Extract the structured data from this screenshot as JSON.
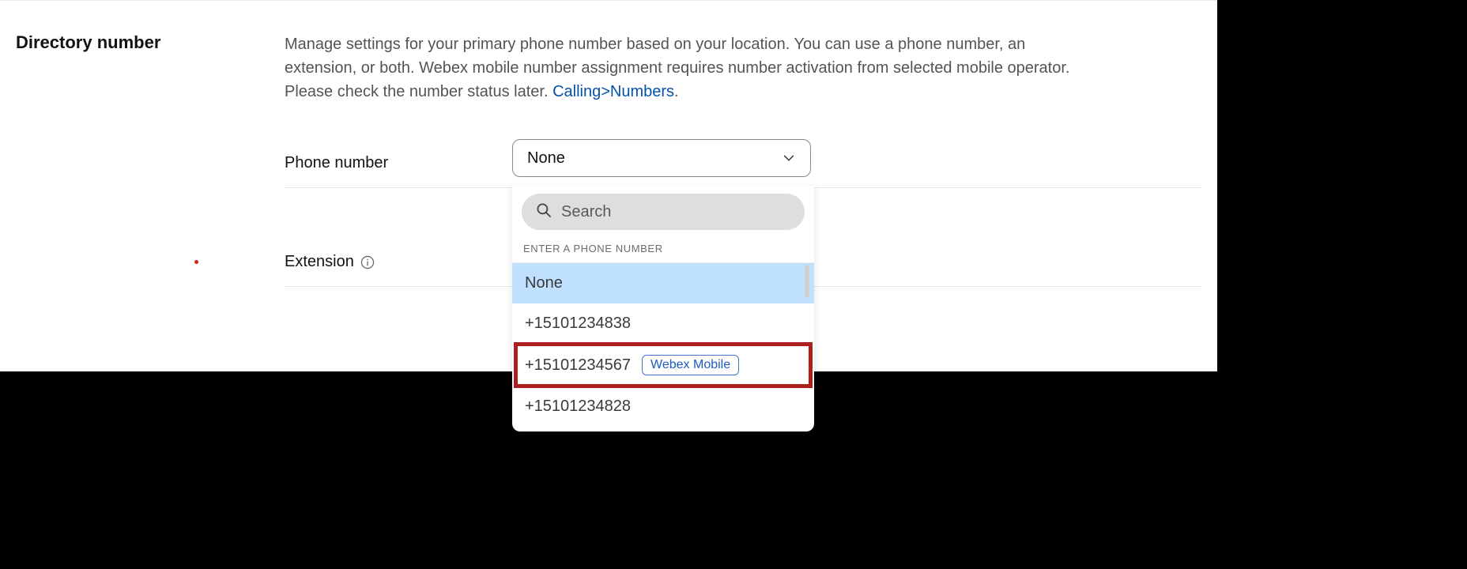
{
  "section": {
    "heading": "Directory number",
    "description_prefix": "Manage settings for your primary phone number based on your location. You can use a phone number, an extension, or both. Webex mobile number assignment requires number activation from selected mobile operator. Please check the number status later. ",
    "description_link": "Calling>Numbers",
    "description_suffix": "."
  },
  "fields": {
    "phone_number": {
      "label": "Phone number",
      "selected": "None"
    },
    "extension": {
      "label": "Extension"
    }
  },
  "dropdown": {
    "search_placeholder": "Search",
    "group_label": "ENTER A PHONE NUMBER",
    "options": [
      {
        "label": "None",
        "selected": true
      },
      {
        "label": "+15101234838"
      },
      {
        "label": "+15101234567",
        "badge": "Webex Mobile",
        "highlight": true
      },
      {
        "label": "+15101234828"
      }
    ]
  }
}
